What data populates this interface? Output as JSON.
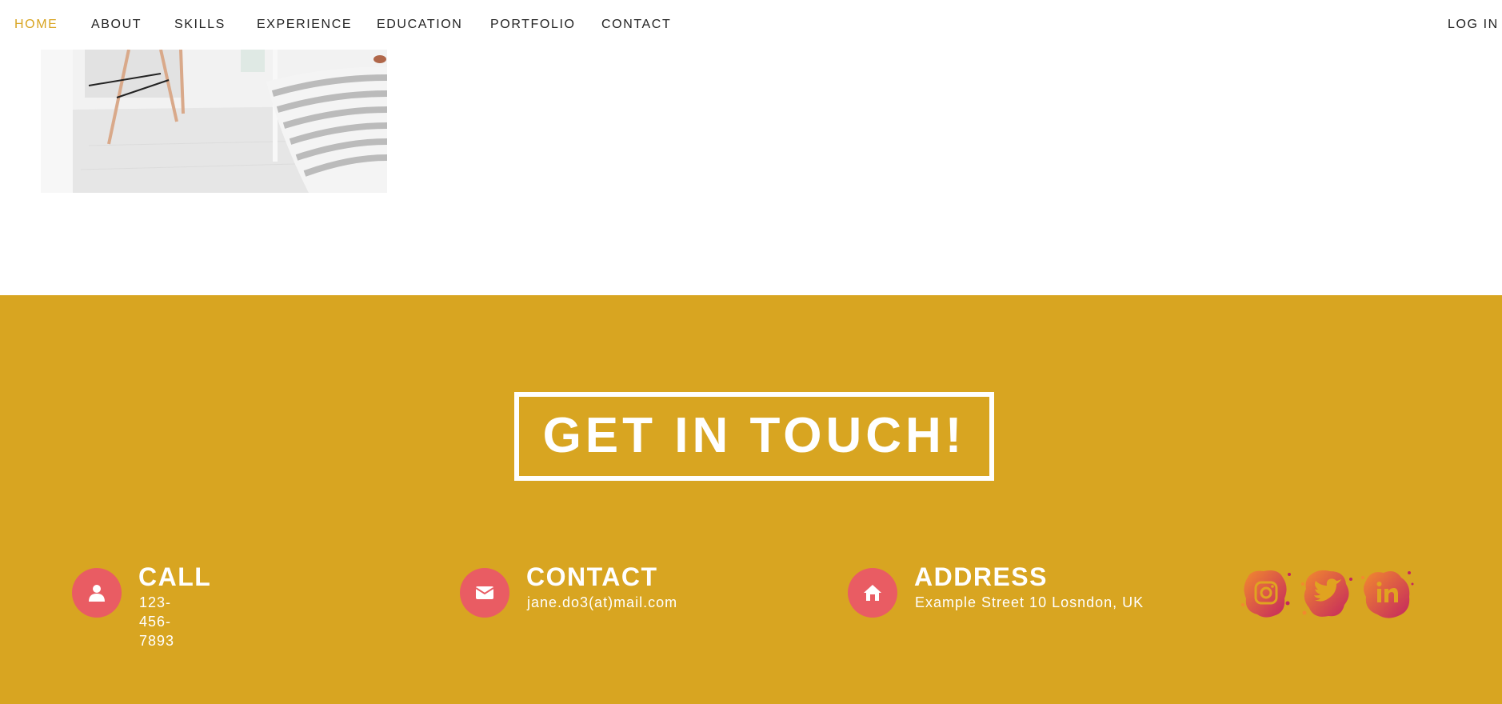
{
  "nav": {
    "items": [
      "HOME",
      "ABOUT",
      "SKILLS",
      "EXPERIENCE",
      "EDUCATION",
      "PORTFOLIO",
      "CONTACT"
    ],
    "active": "HOME",
    "login": "LOG IN"
  },
  "contact": {
    "heading": "GET IN TOUCH!",
    "call": {
      "label": "CALL",
      "value": "123-456-7893",
      "icon": "user-icon"
    },
    "email": {
      "label": "CONTACT",
      "value": "jane.do3(at)mail.com",
      "icon": "envelope-icon"
    },
    "address": {
      "label": "ADDRESS",
      "value": "Example Street 10 Losndon, UK",
      "icon": "home-icon"
    },
    "social": [
      "instagram-icon",
      "twitter-icon",
      "linkedin-icon"
    ]
  },
  "colors": {
    "accent": "#d8a420",
    "section_bg": "#d8a521",
    "icon_circle": "#e95c63",
    "social_gradient_start": "#f28a2e",
    "social_gradient_end": "#c4265f"
  }
}
